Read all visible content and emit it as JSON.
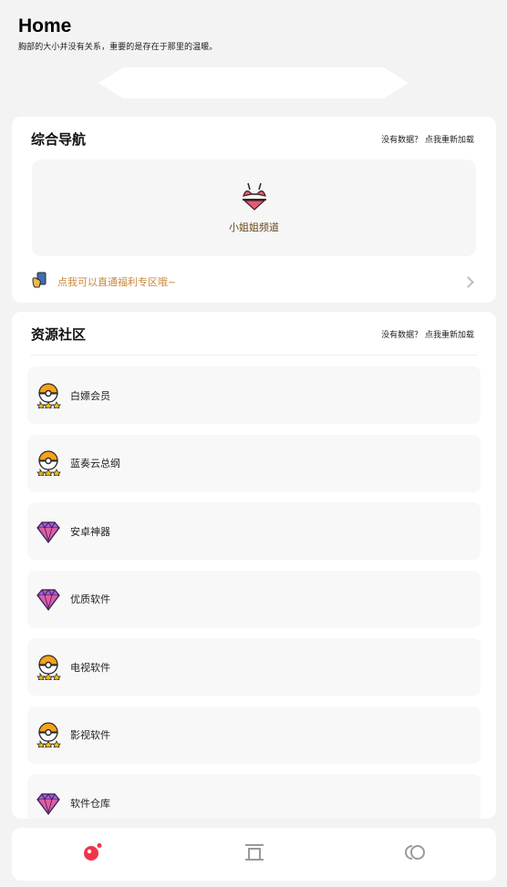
{
  "header": {
    "title": "Home",
    "subtitle": "胸部的大小并没有关系，重要的是存在于那里的温暖。"
  },
  "nav_section": {
    "title": "综合导航",
    "reload_note": "没有数据？ 点我重新加载",
    "channel": {
      "label": "小姐姐频道",
      "icon": "bikini-icon"
    },
    "promo": {
      "text": "点我可以直通福利专区哦~",
      "icon": "phone-hand-icon"
    }
  },
  "resource_section": {
    "title": "资源社区",
    "reload_note": "没有数据？ 点我重新加载",
    "items": [
      {
        "label": "白嫖会员",
        "icon": "pokeball-stars-icon"
      },
      {
        "label": "蓝奏云总纲",
        "icon": "pokeball-stars-icon"
      },
      {
        "label": "安卓神器",
        "icon": "diamond-icon"
      },
      {
        "label": "优质软件",
        "icon": "diamond-icon"
      },
      {
        "label": "电视软件",
        "icon": "pokeball-stars-icon"
      },
      {
        "label": "影视软件",
        "icon": "pokeball-stars-icon"
      },
      {
        "label": "软件仓库",
        "icon": "diamond-icon"
      }
    ]
  },
  "tabbar": {
    "tabs": [
      {
        "icon": "home-dot-icon",
        "active": true,
        "color": "#f0354b"
      },
      {
        "icon": "archive-icon",
        "active": false,
        "color": "#9a9a9a"
      },
      {
        "icon": "rings-icon",
        "active": false,
        "color": "#9a9a9a"
      }
    ]
  },
  "colors": {
    "accent": "#f0354b",
    "promo_text": "#c9873c",
    "channel_text": "#6b4a1f",
    "background": "#f3f3f3"
  }
}
